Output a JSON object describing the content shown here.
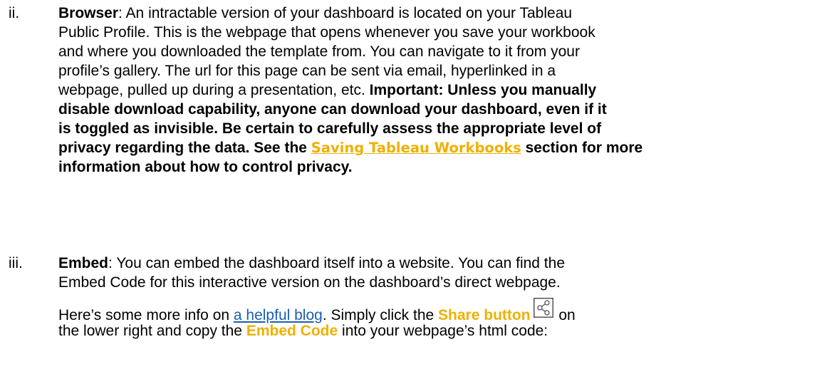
{
  "items": {
    "ii": {
      "numeral": "ii.",
      "term": "Browser",
      "colon": ":",
      "lines": {
        "l1": " An intractable version of your dashboard is located on your Tableau",
        "l2": "Public Profile. This is the webpage that opens whenever you save your workbook",
        "l3": "and where you downloaded the template from. You can navigate to it from your",
        "l4": "profile’s gallery. The url for this page can be sent via email, hyperlinked in a",
        "l5a": "webpage, pulled up during a presentation, etc. ",
        "l5b": "Important: Unless you manually",
        "l6": "disable download capability, anyone can download your dashboard, even if it",
        "l7": "is toggled as invisible. Be certain to carefully assess the appropriate level of",
        "l8a": "privacy regarding the data. See the ",
        "l8link": "Saving Tableau Workbooks",
        "l8b": " section for more",
        "l9": "information about how to control privacy."
      }
    },
    "iii": {
      "numeral": "iii.",
      "term": "Embed",
      "colon": ":",
      "lines": {
        "l1": " You can embed the dashboard itself into a website. You can find the",
        "l2": "Embed Code for this interactive version on the dashboard’s direct webpage.",
        "l3a": "Here’s some more info on ",
        "l3link": "a helpful blog",
        "l3b": ". Simply click the ",
        "l3share": "Share button",
        "l4a": "the lower right and copy the ",
        "l4embed": "Embed Code",
        "l4b": " into your webpage’s html code:"
      },
      "share_icon": "share-icon",
      "on_text": " on"
    }
  },
  "colors": {
    "text": "#000000",
    "link_gold": "#f0b000",
    "link_blue": "#1a5fb4",
    "highlight": "#f0b000"
  }
}
